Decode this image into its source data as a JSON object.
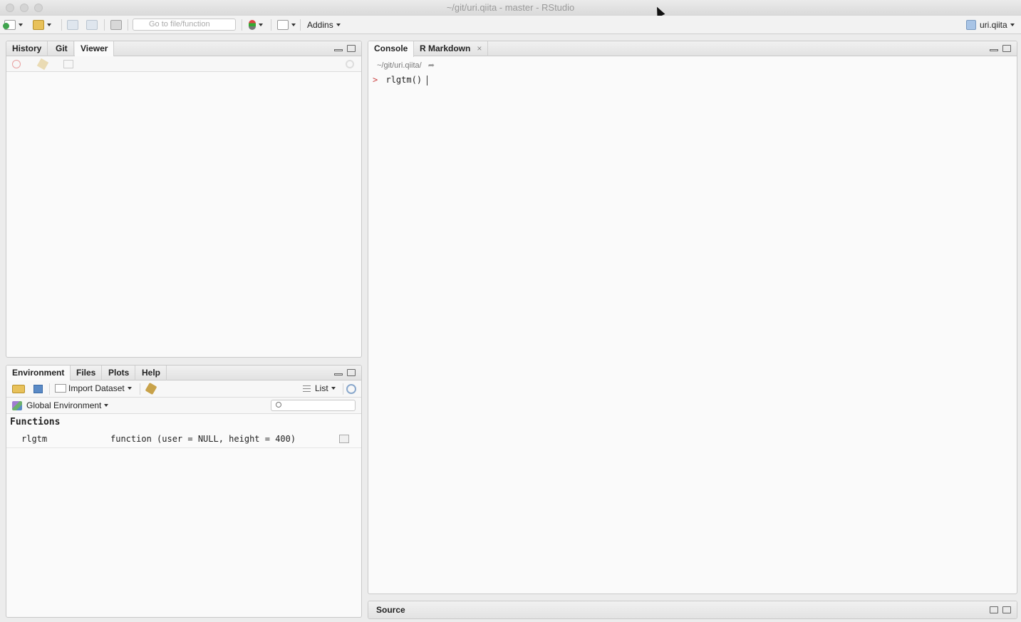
{
  "window": {
    "title": "~/git/uri.qiita - master - RStudio"
  },
  "toolbar": {
    "goto_placeholder": "Go to file/function",
    "addins_label": "Addins",
    "project_label": "uri.qiita"
  },
  "top_left_pane": {
    "tabs": [
      "History",
      "Git",
      "Viewer"
    ],
    "active_tab": "Viewer"
  },
  "bottom_left_pane": {
    "tabs": [
      "Environment",
      "Files",
      "Plots",
      "Help"
    ],
    "active_tab": "Environment",
    "import_dataset_label": "Import Dataset",
    "view_mode_label": "List",
    "environment_label": "Global Environment",
    "section_heading": "Functions",
    "rows": [
      {
        "name": "rlgtm",
        "value": "function (user = NULL, height = 400)"
      }
    ]
  },
  "console_pane": {
    "tabs": [
      "Console",
      "R Markdown"
    ],
    "active_tab": "Console",
    "working_dir": "~/git/uri.qiita/",
    "prompt": ">",
    "input": "rlgtm()"
  },
  "source_pane": {
    "title": "Source"
  },
  "colors": {
    "prompt": "#cc4444",
    "accent": "#4a90d9"
  }
}
